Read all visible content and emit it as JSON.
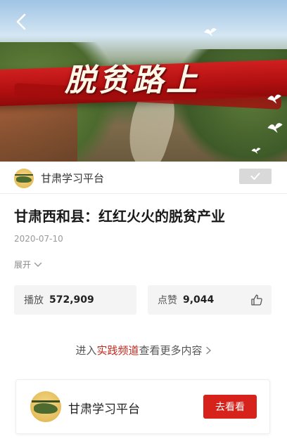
{
  "hero": {
    "banner_text": "脱贫路上"
  },
  "channel": {
    "name": "甘肃学习平台"
  },
  "article": {
    "title": "甘肃西和县：红红火火的脱贫产业",
    "date": "2020-07-10",
    "expand_label": "展开"
  },
  "stats": {
    "play_label": "播放",
    "play_count": "572,909",
    "like_label": "点赞",
    "like_count": "9,044"
  },
  "more": {
    "prefix": "进入",
    "highlight": "实践频道",
    "suffix": "查看更多内容"
  },
  "promo": {
    "name": "甘肃学习平台",
    "button_label": "去看看"
  },
  "colors": {
    "accent_red": "#d7211b",
    "highlight_red": "#c0281e"
  }
}
